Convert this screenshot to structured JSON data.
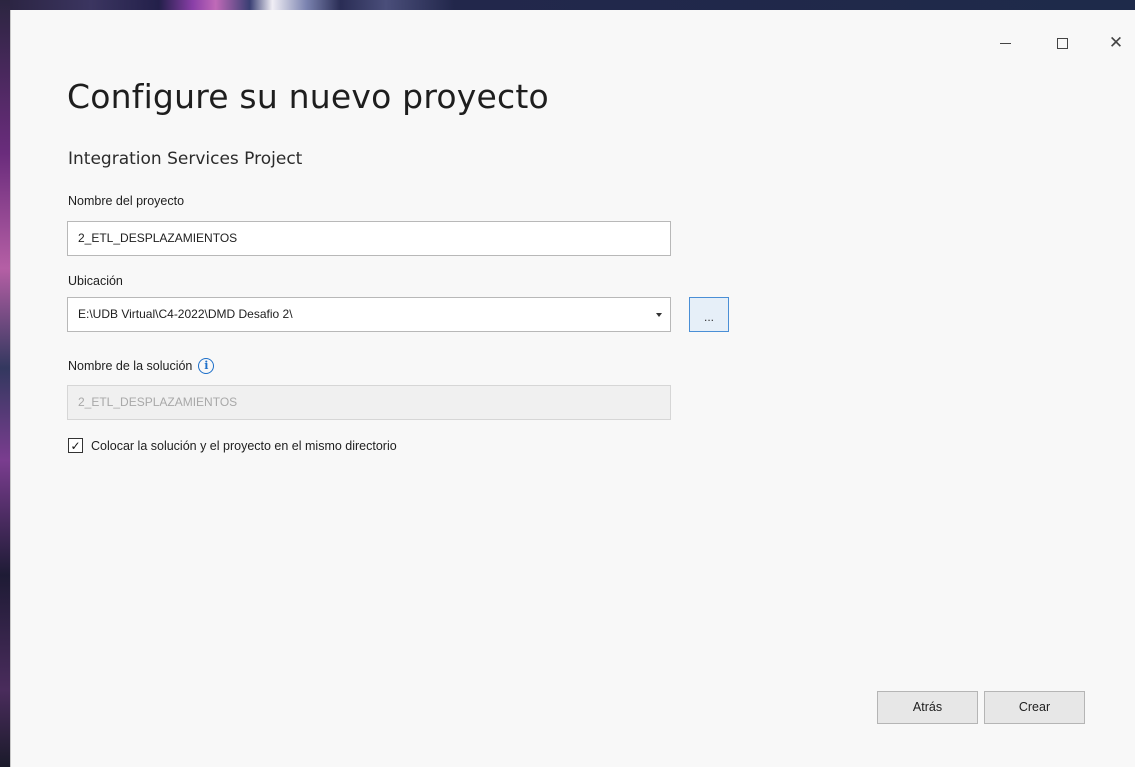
{
  "window": {
    "title": "Configure su nuevo proyecto",
    "subtitle": "Integration Services Project"
  },
  "caption": {
    "minimize_glyph": "—",
    "maximize_glyph": "☐",
    "close_glyph": "✕"
  },
  "form": {
    "project_name_label": "Nombre del proyecto",
    "project_name_value": "2_ETL_DESPLAZAMIENTOS",
    "location_label": "Ubicación",
    "location_value": "E:\\UDB Virtual\\C4-2022\\DMD Desafio 2\\",
    "browse_label": "...",
    "solution_name_label": "Nombre de la solución",
    "solution_name_value": "2_ETL_DESPLAZAMIENTOS",
    "same_dir_checkbox_label": "Colocar la solución y el proyecto en el mismo directorio",
    "same_dir_checked": true
  },
  "footer": {
    "back_label": "Atrás",
    "create_label": "Crear"
  },
  "icons": {
    "info": "info-icon",
    "dropdown": "chevron-down-icon",
    "check": "checkmark-icon"
  },
  "colors": {
    "accent": "#1d6fc9",
    "window_bg": "#f8f8f8",
    "button_bg": "#e7e7e7"
  }
}
